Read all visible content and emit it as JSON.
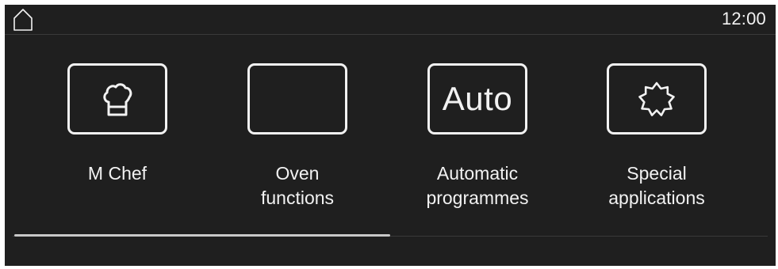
{
  "header": {
    "home_icon": "home-icon",
    "clock": "12:00"
  },
  "tiles": [
    {
      "icon": "chef-hat-icon",
      "label_lines": [
        "M Chef"
      ]
    },
    {
      "icon": "oven-functions-icon",
      "label_lines": [
        "Oven",
        "functions"
      ]
    },
    {
      "icon": "auto-icon",
      "icon_text": "Auto",
      "label_lines": [
        "Automatic",
        "programmes"
      ]
    },
    {
      "icon": "special-star-icon",
      "label_lines": [
        "Special",
        "applications"
      ]
    }
  ],
  "scroll": {
    "position_fraction": 0.5
  },
  "colors": {
    "background": "#1f1f1f",
    "foreground": "#f2f2f2",
    "indicator": "#c8c8c8",
    "divider": "#3a3a3a"
  }
}
